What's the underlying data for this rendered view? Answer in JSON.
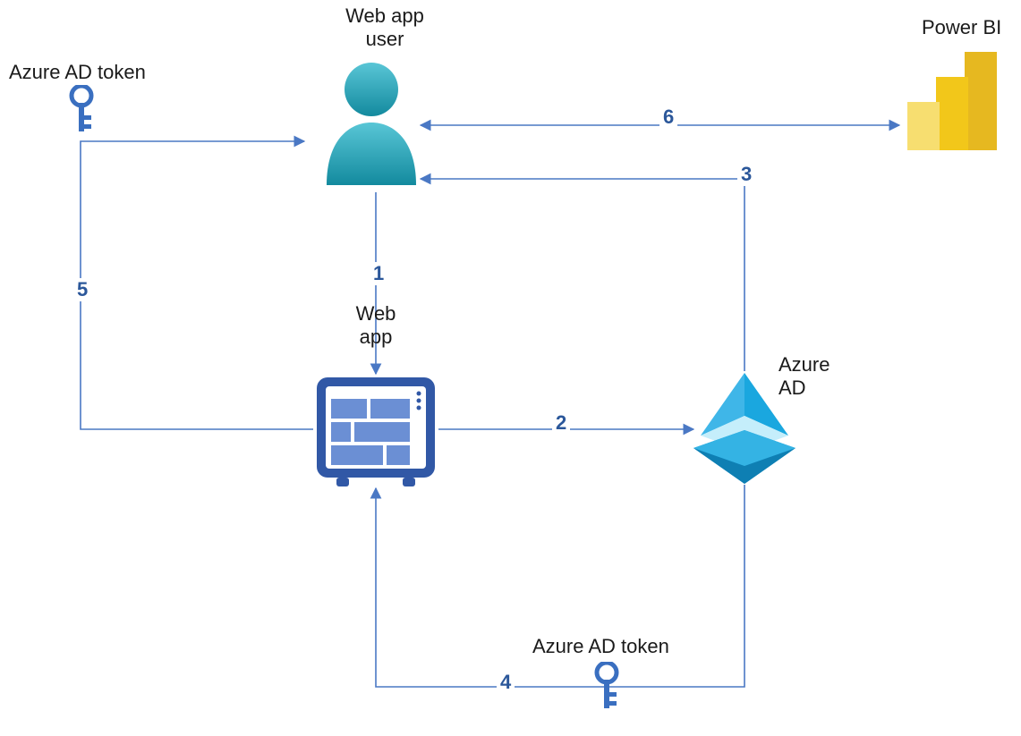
{
  "nodes": {
    "user": {
      "label": "Web app\nuser"
    },
    "powerbi": {
      "label": "Power BI"
    },
    "token_left": {
      "label": "Azure AD token"
    },
    "token_bottom": {
      "label": "Azure AD token"
    },
    "webapp": {
      "label": "Web\napp"
    },
    "azuread": {
      "label": "Azure\nAD"
    }
  },
  "steps": {
    "s1": "1",
    "s2": "2",
    "s3": "3",
    "s4": "4",
    "s5": "5",
    "s6": "6"
  },
  "colors": {
    "line": "#4a78c4",
    "step": "#2b579a",
    "user_dark": "#138a9e",
    "user_light": "#59c6d6",
    "key": "#3a6fc0",
    "webapp_stroke": "#3158a6",
    "webapp_fill": "#6b8fd4",
    "azuread_top": "#3fb6e8",
    "azuread_bottom": "#1296d1",
    "pbi1": "#e6b820",
    "pbi2": "#f2c71a",
    "pbi3": "#f7de70"
  }
}
